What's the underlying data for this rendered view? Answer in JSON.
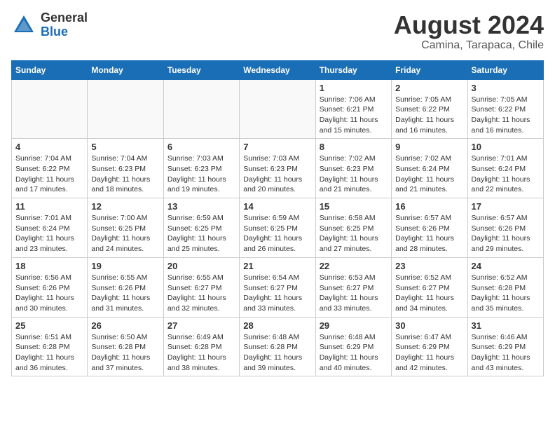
{
  "header": {
    "logo_general": "General",
    "logo_blue": "Blue",
    "month_year": "August 2024",
    "location": "Camina, Tarapaca, Chile"
  },
  "weekdays": [
    "Sunday",
    "Monday",
    "Tuesday",
    "Wednesday",
    "Thursday",
    "Friday",
    "Saturday"
  ],
  "weeks": [
    [
      {
        "day": "",
        "info": ""
      },
      {
        "day": "",
        "info": ""
      },
      {
        "day": "",
        "info": ""
      },
      {
        "day": "",
        "info": ""
      },
      {
        "day": "1",
        "info": "Sunrise: 7:06 AM\nSunset: 6:21 PM\nDaylight: 11 hours\nand 15 minutes."
      },
      {
        "day": "2",
        "info": "Sunrise: 7:05 AM\nSunset: 6:22 PM\nDaylight: 11 hours\nand 16 minutes."
      },
      {
        "day": "3",
        "info": "Sunrise: 7:05 AM\nSunset: 6:22 PM\nDaylight: 11 hours\nand 16 minutes."
      }
    ],
    [
      {
        "day": "4",
        "info": "Sunrise: 7:04 AM\nSunset: 6:22 PM\nDaylight: 11 hours\nand 17 minutes."
      },
      {
        "day": "5",
        "info": "Sunrise: 7:04 AM\nSunset: 6:23 PM\nDaylight: 11 hours\nand 18 minutes."
      },
      {
        "day": "6",
        "info": "Sunrise: 7:03 AM\nSunset: 6:23 PM\nDaylight: 11 hours\nand 19 minutes."
      },
      {
        "day": "7",
        "info": "Sunrise: 7:03 AM\nSunset: 6:23 PM\nDaylight: 11 hours\nand 20 minutes."
      },
      {
        "day": "8",
        "info": "Sunrise: 7:02 AM\nSunset: 6:23 PM\nDaylight: 11 hours\nand 21 minutes."
      },
      {
        "day": "9",
        "info": "Sunrise: 7:02 AM\nSunset: 6:24 PM\nDaylight: 11 hours\nand 21 minutes."
      },
      {
        "day": "10",
        "info": "Sunrise: 7:01 AM\nSunset: 6:24 PM\nDaylight: 11 hours\nand 22 minutes."
      }
    ],
    [
      {
        "day": "11",
        "info": "Sunrise: 7:01 AM\nSunset: 6:24 PM\nDaylight: 11 hours\nand 23 minutes."
      },
      {
        "day": "12",
        "info": "Sunrise: 7:00 AM\nSunset: 6:25 PM\nDaylight: 11 hours\nand 24 minutes."
      },
      {
        "day": "13",
        "info": "Sunrise: 6:59 AM\nSunset: 6:25 PM\nDaylight: 11 hours\nand 25 minutes."
      },
      {
        "day": "14",
        "info": "Sunrise: 6:59 AM\nSunset: 6:25 PM\nDaylight: 11 hours\nand 26 minutes."
      },
      {
        "day": "15",
        "info": "Sunrise: 6:58 AM\nSunset: 6:25 PM\nDaylight: 11 hours\nand 27 minutes."
      },
      {
        "day": "16",
        "info": "Sunrise: 6:57 AM\nSunset: 6:26 PM\nDaylight: 11 hours\nand 28 minutes."
      },
      {
        "day": "17",
        "info": "Sunrise: 6:57 AM\nSunset: 6:26 PM\nDaylight: 11 hours\nand 29 minutes."
      }
    ],
    [
      {
        "day": "18",
        "info": "Sunrise: 6:56 AM\nSunset: 6:26 PM\nDaylight: 11 hours\nand 30 minutes."
      },
      {
        "day": "19",
        "info": "Sunrise: 6:55 AM\nSunset: 6:26 PM\nDaylight: 11 hours\nand 31 minutes."
      },
      {
        "day": "20",
        "info": "Sunrise: 6:55 AM\nSunset: 6:27 PM\nDaylight: 11 hours\nand 32 minutes."
      },
      {
        "day": "21",
        "info": "Sunrise: 6:54 AM\nSunset: 6:27 PM\nDaylight: 11 hours\nand 33 minutes."
      },
      {
        "day": "22",
        "info": "Sunrise: 6:53 AM\nSunset: 6:27 PM\nDaylight: 11 hours\nand 33 minutes."
      },
      {
        "day": "23",
        "info": "Sunrise: 6:52 AM\nSunset: 6:27 PM\nDaylight: 11 hours\nand 34 minutes."
      },
      {
        "day": "24",
        "info": "Sunrise: 6:52 AM\nSunset: 6:28 PM\nDaylight: 11 hours\nand 35 minutes."
      }
    ],
    [
      {
        "day": "25",
        "info": "Sunrise: 6:51 AM\nSunset: 6:28 PM\nDaylight: 11 hours\nand 36 minutes."
      },
      {
        "day": "26",
        "info": "Sunrise: 6:50 AM\nSunset: 6:28 PM\nDaylight: 11 hours\nand 37 minutes."
      },
      {
        "day": "27",
        "info": "Sunrise: 6:49 AM\nSunset: 6:28 PM\nDaylight: 11 hours\nand 38 minutes."
      },
      {
        "day": "28",
        "info": "Sunrise: 6:48 AM\nSunset: 6:28 PM\nDaylight: 11 hours\nand 39 minutes."
      },
      {
        "day": "29",
        "info": "Sunrise: 6:48 AM\nSunset: 6:29 PM\nDaylight: 11 hours\nand 40 minutes."
      },
      {
        "day": "30",
        "info": "Sunrise: 6:47 AM\nSunset: 6:29 PM\nDaylight: 11 hours\nand 42 minutes."
      },
      {
        "day": "31",
        "info": "Sunrise: 6:46 AM\nSunset: 6:29 PM\nDaylight: 11 hours\nand 43 minutes."
      }
    ]
  ]
}
